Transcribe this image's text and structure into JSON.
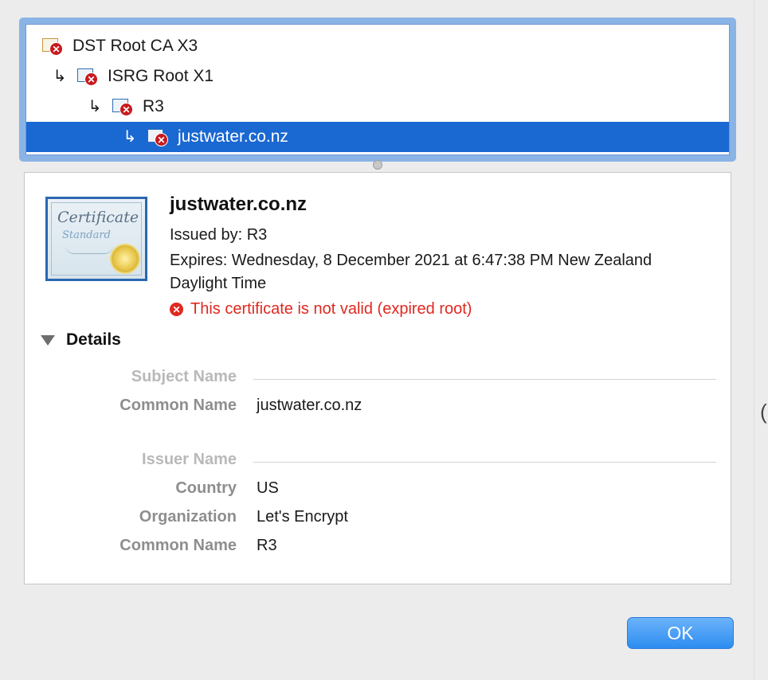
{
  "chain": [
    {
      "label": "DST Root CA X3",
      "icon": "certificate-error-icon",
      "arrow": ""
    },
    {
      "label": "ISRG Root X1",
      "icon": "certificate-error-icon",
      "arrow": "↳"
    },
    {
      "label": "R3",
      "icon": "certificate-error-icon",
      "arrow": "↳"
    },
    {
      "label": "justwater.co.nz",
      "icon": "certificate-error-icon",
      "arrow": "↳",
      "selected": true
    }
  ],
  "detail": {
    "title": "justwater.co.nz",
    "issued_by": "Issued by: R3",
    "expires": "Expires: Wednesday, 8 December 2021 at 6:47:38 PM New Zealand Daylight Time",
    "status": "This certificate is not valid (expired root)",
    "status_color": "#e0281f",
    "cert_image": {
      "line1": "Certificate",
      "line2": "Standard"
    },
    "details_label": "Details",
    "subject_section": "Subject Name",
    "subject_common_name_key": "Common Name",
    "subject_common_name": "justwater.co.nz",
    "issuer_section": "Issuer Name",
    "country_key": "Country",
    "country": "US",
    "organization_key": "Organization",
    "organization": "Let's Encrypt",
    "issuer_common_name_key": "Common Name",
    "issuer_common_name": "R3"
  },
  "ok_label": "OK",
  "edge_glyph": "(",
  "colors": {
    "selection": "#1a68d1",
    "accent": "#2d8cf0",
    "error": "#c8191d"
  }
}
